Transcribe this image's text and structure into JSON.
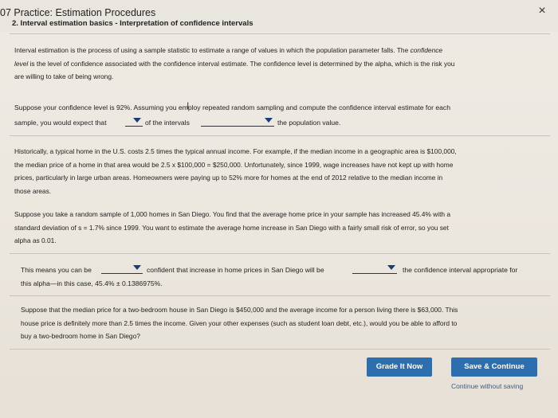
{
  "header": {
    "title": "07 Practice: Estimation Procedures",
    "subtitle": "2. Interval estimation basics - Interpretation of confidence intervals",
    "close_icon": "×"
  },
  "intro": {
    "line1_a": "Interval estimation is the process of using a sample statistic to estimate a range of values in which the population parameter falls. The ",
    "line1_em": "confidence",
    "line2_em": "level",
    "line2_b": " is the level of confidence associated with the confidence interval estimate. The confidence level is determined by the alpha, which is the risk you",
    "line3": "are willing to take of being wrong."
  },
  "q1": {
    "line1": "Suppose your confidence level is 92%. Assuming you employ repeated random sampling and compute the confidence interval estimate for each",
    "pre": "sample, you would expect that",
    "mid": "of the intervals",
    "post": "the population value.",
    "dropdown1_value": "",
    "dropdown2_value": ""
  },
  "historic": {
    "l1": "Historically, a typical home in the U.S. costs 2.5 times the typical annual income. For example, if the median income in a geographic area is $100,000,",
    "l2": "the median price of a home in that area would be 2.5 x $100,000 = $250,000. Unfortunately, since 1999, wage increases have not kept up with home",
    "l3": "prices, particularly in large urban areas. Homeowners were paying up to 52% more for homes at the end of 2012 relative to the median income in",
    "l4": "those areas."
  },
  "sample": {
    "l1": "Suppose you take a random sample of 1,000 homes in San Diego. You find that the average home price in your sample has increased 45.4% with a",
    "l2": "standard deviation of s = 1.7% since 1999. You want to estimate the average home increase in San Diego with a fairly small risk of error, so you set",
    "l3": "alpha as 0.01."
  },
  "q2": {
    "pre": "This means you can be",
    "mid": "confident that increase in home prices in San Diego will be",
    "post": "the confidence interval appropriate for",
    "line2": "this alpha—in this case, 45.4% ± 0.1386975%.",
    "dropdown1_value": "",
    "dropdown2_value": ""
  },
  "twobed": {
    "l1": "Suppose that the median price for a two-bedroom house in San Diego is $450,000 and the average income for a person living there is $63,000. This",
    "l2": "house price is definitely more than 2.5 times the income. Given your other expenses (such as student loan debt, etc.), would you be able to afford to",
    "l3": "buy a two-bedroom home in San Diego?"
  },
  "footer": {
    "grade_label": "Grade It Now",
    "save_label": "Save & Continue",
    "continue_link": "Continue without saving"
  }
}
